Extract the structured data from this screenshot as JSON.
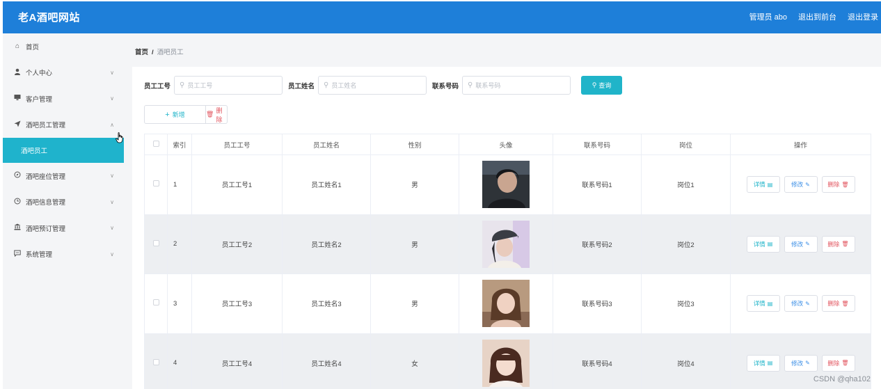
{
  "brand": "老A酒吧网站",
  "top_links": {
    "admin": "管理员 abo",
    "backend": "退出到前台",
    "logout": "退出登录"
  },
  "sidebar": {
    "items": [
      {
        "label": "首页",
        "icon": "home-icon",
        "glyph": "⌂",
        "chevron": ""
      },
      {
        "label": "个人中心",
        "icon": "user-icon",
        "glyph": "👤",
        "chevron": "∨"
      },
      {
        "label": "客户管理",
        "icon": "monitor-icon",
        "glyph": "▬",
        "chevron": "∨"
      },
      {
        "label": "酒吧员工管理",
        "icon": "send-icon",
        "glyph": "✈",
        "chevron": "∧"
      },
      {
        "label": "酒吧员工",
        "icon": "",
        "glyph": "",
        "chevron": "",
        "active": true
      },
      {
        "label": "酒吧座位管理",
        "icon": "compass-icon",
        "glyph": "◷",
        "chevron": "∨"
      },
      {
        "label": "酒吧信息管理",
        "icon": "clock-icon",
        "glyph": "◔",
        "chevron": "∨"
      },
      {
        "label": "酒吧预订管理",
        "icon": "bank-icon",
        "glyph": "▁",
        "chevron": "∨"
      },
      {
        "label": "系统管理",
        "icon": "message-icon",
        "glyph": "▭",
        "chevron": "∨"
      }
    ]
  },
  "breadcrumb": {
    "home": "首页",
    "sep": "/",
    "current": "酒吧员工"
  },
  "search": {
    "fields": [
      {
        "label": "员工工号",
        "placeholder": "员工工号"
      },
      {
        "label": "员工姓名",
        "placeholder": "员工姓名"
      },
      {
        "label": "联系号码",
        "placeholder": "联系号码"
      }
    ],
    "query_label": "查询"
  },
  "actions": {
    "add": "新增",
    "delete": "删除"
  },
  "table": {
    "headers": [
      "",
      "索引",
      "员工工号",
      "员工姓名",
      "性别",
      "头像",
      "联系号码",
      "岗位",
      "操作"
    ],
    "rows": [
      {
        "index": "1",
        "emp_no": "员工工号1",
        "name": "员工姓名1",
        "gender": "男",
        "phone": "联系号码1",
        "post": "岗位1"
      },
      {
        "index": "2",
        "emp_no": "员工工号2",
        "name": "员工姓名2",
        "gender": "男",
        "phone": "联系号码2",
        "post": "岗位2"
      },
      {
        "index": "3",
        "emp_no": "员工工号3",
        "name": "员工姓名3",
        "gender": "男",
        "phone": "联系号码3",
        "post": "岗位3"
      },
      {
        "index": "4",
        "emp_no": "员工工号4",
        "name": "员工姓名4",
        "gender": "女",
        "phone": "联系号码4",
        "post": "岗位4"
      }
    ],
    "ops": {
      "detail": "详情",
      "edit": "修改",
      "remove": "删除"
    }
  },
  "watermark": "CSDN @qha102",
  "colors": {
    "topbar": "#1e7fd9",
    "accent": "#20b4c9",
    "danger": "#e2555f",
    "sidebar_active": "#1fb3cc"
  }
}
